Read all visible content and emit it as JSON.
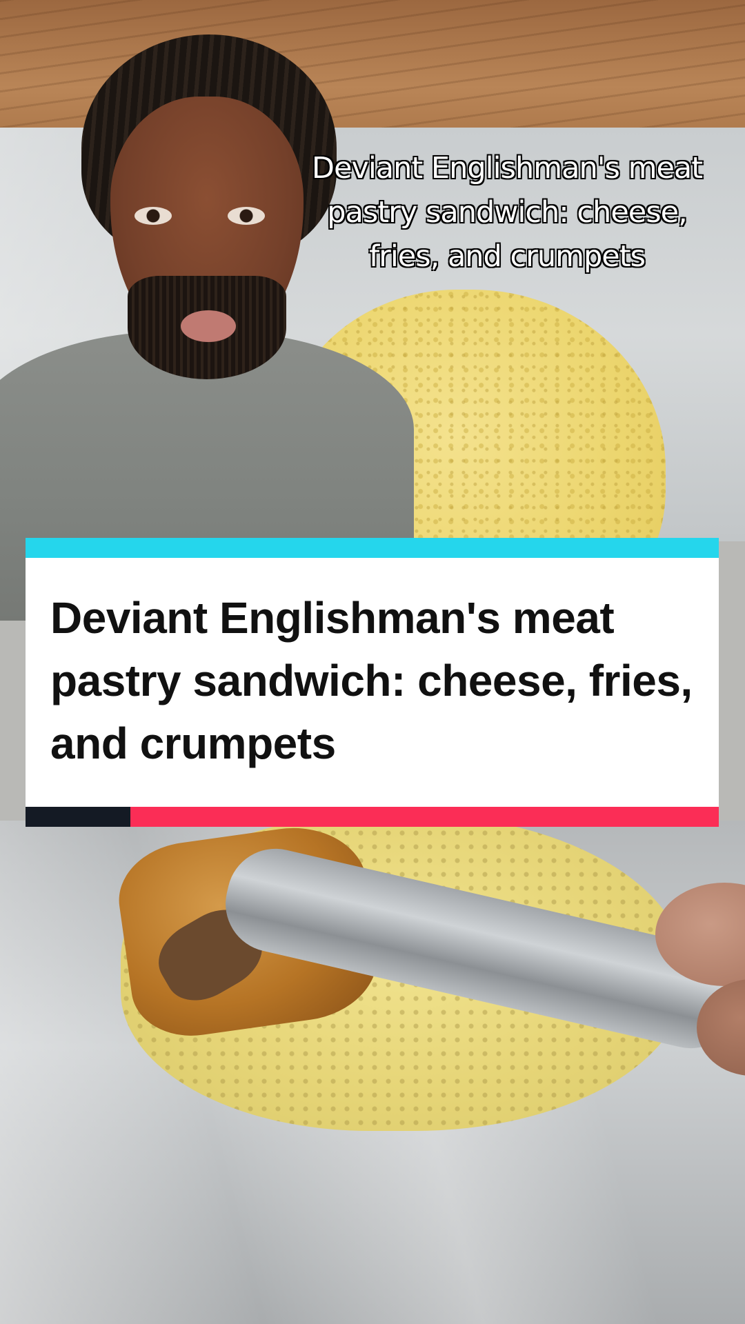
{
  "video": {
    "overlay_caption": "Deviant Englishman's meat pastry sandwich: cheese, fries, and crumpets"
  },
  "title_card": {
    "headline": "Deviant Englishman's meat pastry sandwich: cheese, fries, and crumpets",
    "colors": {
      "top_bar": "#25d6ec",
      "background": "#ffffff",
      "text": "#111111",
      "bottom_bar_dark": "#141a24",
      "bottom_bar_accent": "#fb2d56"
    }
  }
}
